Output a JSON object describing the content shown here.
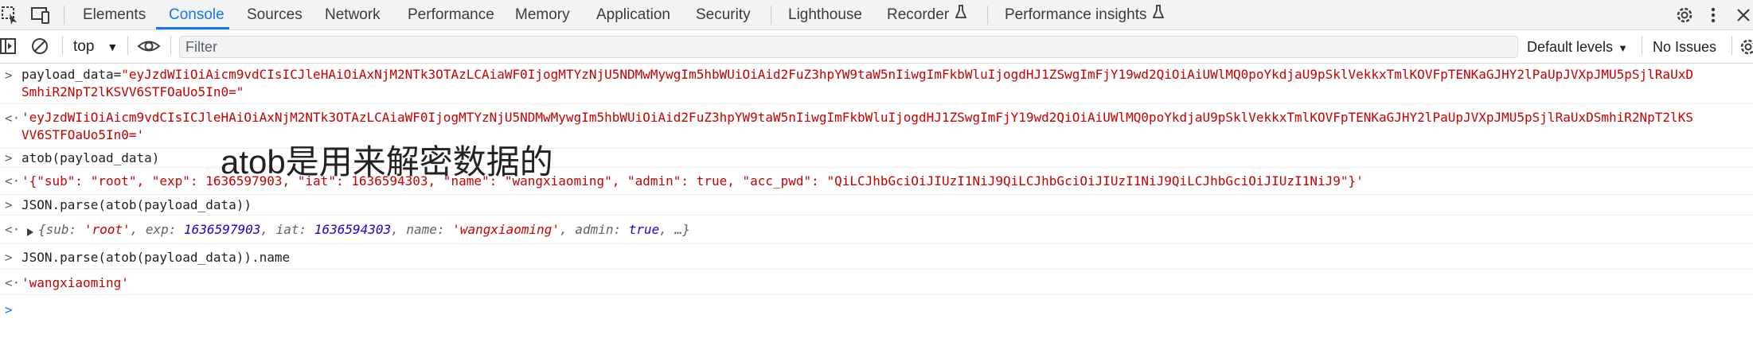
{
  "tabs": [
    {
      "label": "Elements",
      "active": false
    },
    {
      "label": "Console",
      "active": true
    },
    {
      "label": "Sources",
      "active": false
    },
    {
      "label": "Network",
      "active": false
    },
    {
      "label": "Performance",
      "active": false
    },
    {
      "label": "Memory",
      "active": false
    },
    {
      "label": "Application",
      "active": false
    },
    {
      "label": "Security",
      "active": false
    },
    {
      "label": "Lighthouse",
      "active": false
    },
    {
      "label": "Recorder",
      "active": false
    },
    {
      "label": "Performance insights",
      "active": false
    }
  ],
  "toolbar": {
    "context": "top",
    "filter_placeholder": "Filter",
    "levels_label": "Default levels",
    "issues_label": "No Issues"
  },
  "console": {
    "entry1": {
      "cmd_prefix": "payload_data=",
      "cmd_line1": "\"eyJzdWIiOiAicm9vdCIsICJleHAiOiAxNjM2NTk3OTAzLCAiaWF0IjogMTYzNjU5NDMwMywgIm5hbWUiOiAid2FuZ3hpYW9taW5nIiwgImFkbWluIjogdHJ1ZSwgImFjY19wd2QiOiAiUWlMQ0poYkdjaU9pSklVekkxTmlKOVFpTENKaGJHY2lPaUpJVXpJMU5pSjlRaUxD",
      "cmd_line2": "SmhiR2NpT2lKSVV6STFOaUo5In0=\"",
      "res_line1": "'eyJzdWIiOiAicm9vdCIsICJleHAiOiAxNjM2NTk3OTAzLCAiaWF0IjogMTYzNjU5NDMwMywgIm5hbWUiOiAid2FuZ3hpYW9taW5nIiwgImFkbWluIjogdHJ1ZSwgImFjY19wd2QiOiAiUWlMQ0poYkdjaU9pSklVekkxTmlKOVFpTENKaGJHY2lPaUpJVXpJMU5pSjlRaUxDSmhiR2NpT2lKS",
      "res_line2": "VV6STFOaUo5In0='"
    },
    "entry2": {
      "cmd": "atob(payload_data)",
      "result": "'{\"sub\": \"root\", \"exp\": 1636597903, \"iat\": 1636594303, \"name\": \"wangxiaoming\", \"admin\": true, \"acc_pwd\": \"QiLCJhbGciOiJIUzI1NiJ9QiLCJhbGciOiJIUzI1NiJ9QiLCJhbGciOiJIUzI1NiJ9\"}'"
    },
    "entry3": {
      "cmd": "JSON.parse(atob(payload_data))",
      "obj_open": "{",
      "k_sub": "sub: ",
      "v_sub": "'root'",
      "k_exp": "exp: ",
      "v_exp": "1636597903",
      "k_iat": "iat: ",
      "v_iat": "1636594303",
      "k_name": "name: ",
      "v_name": "'wangxiaoming'",
      "k_admin": "admin: ",
      "v_admin": "true",
      "obj_tail": ", …}"
    },
    "entry4": {
      "cmd": "JSON.parse(atob(payload_data)).name",
      "result": "'wangxiaoming'"
    }
  },
  "annotation": "atob是用来解密数据的",
  "colors": {
    "accent": "#1a73e8",
    "string": "#c80000",
    "number": "#1c00cf"
  },
  "icons": [
    "inspect-element-icon",
    "device-toolbar-icon",
    "flask-icon",
    "settings-gear-icon",
    "more-vert-icon",
    "close-icon",
    "sidebar-toggle-icon",
    "clear-console-icon",
    "eye-icon",
    "console-settings-icon",
    "chevron-right-icon",
    "return-arrow-icon",
    "expand-triangle-icon"
  ]
}
